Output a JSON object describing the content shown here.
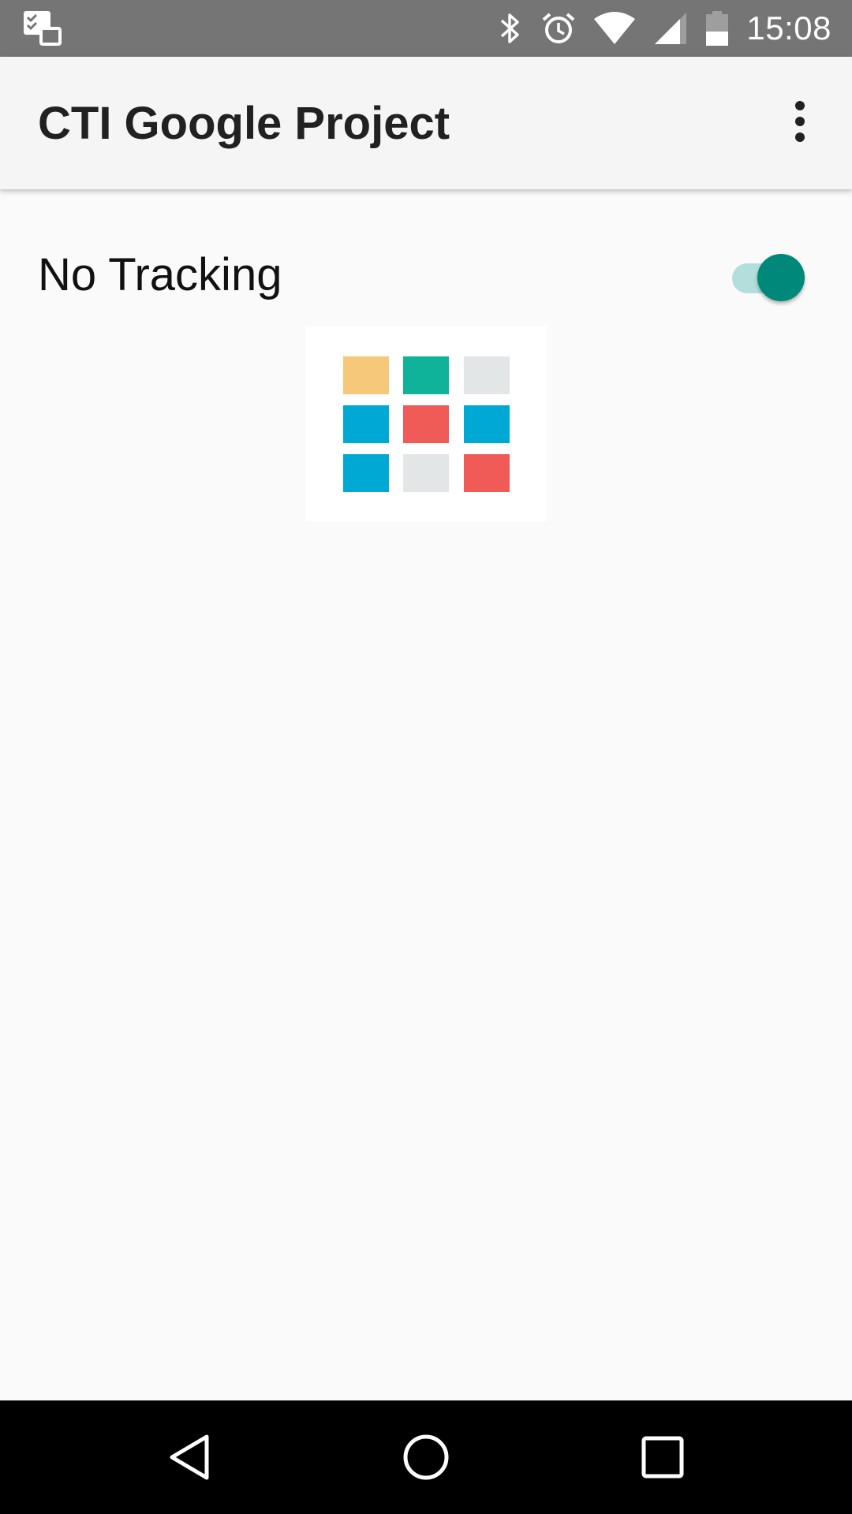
{
  "status_bar": {
    "time": "15:08",
    "icons": [
      "notification-stack-icon",
      "bluetooth-icon",
      "alarm-icon",
      "wifi-icon",
      "cellular-signal-icon",
      "battery-icon"
    ]
  },
  "app_bar": {
    "title": "CTI Google Project",
    "overflow_icon": "more-vert-icon"
  },
  "tracking": {
    "label": "No Tracking",
    "switch_on": true
  },
  "logo": {
    "tiles": [
      "#f5c87a",
      "#0fb39a",
      "#e2e6e6",
      "#00a9d3",
      "#f05a57",
      "#00a9d3",
      "#00a9d3",
      "#e2e6e6",
      "#f05a57"
    ]
  },
  "nav_bar": {
    "buttons": [
      "back-icon",
      "home-icon",
      "recents-icon"
    ]
  },
  "colors": {
    "status_bar": "#757575",
    "app_bar": "#f5f5f5",
    "background": "#fafafa",
    "switch_thumb": "#00897b",
    "switch_track": "#b2dfdb"
  }
}
